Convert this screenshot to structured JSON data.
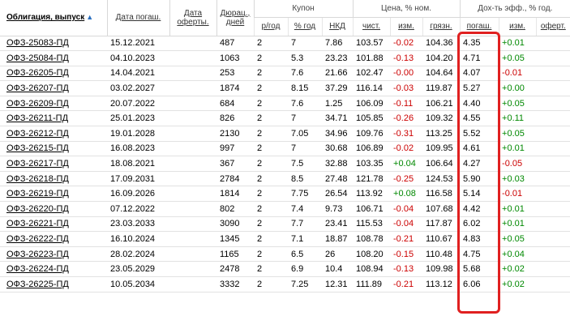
{
  "header": {
    "bond": "Облигация, выпуск",
    "maturity": "Дата погаш.",
    "offer": "Дата оферты.",
    "duration": "Дюрац., дней",
    "coupon": "Купон",
    "price": "Цена, % ном.",
    "yield": "Дох-ть эфф., % год.",
    "sub": {
      "freq": "р/год",
      "rate": "% год",
      "nkd": "НКД",
      "clean": "чист.",
      "chg": "изм.",
      "dirty": "грязн.",
      "ytm": "погаш.",
      "ychg": "изм.",
      "yoffer": "оферт."
    }
  },
  "rows": [
    {
      "name": "ОФЗ-25083-ПД",
      "mat": "15.12.2021",
      "dur": "487",
      "freq": "2",
      "rate": "7",
      "nkd": "7.86",
      "clean": "103.57",
      "chg": "-0.02",
      "dirty": "104.36",
      "ytm": "4.35",
      "ychg": "+0.01"
    },
    {
      "name": "ОФЗ-25084-ПД",
      "mat": "04.10.2023",
      "dur": "1063",
      "freq": "2",
      "rate": "5.3",
      "nkd": "23.23",
      "clean": "101.88",
      "chg": "-0.13",
      "dirty": "104.20",
      "ytm": "4.71",
      "ychg": "+0.05"
    },
    {
      "name": "ОФЗ-26205-ПД",
      "mat": "14.04.2021",
      "dur": "253",
      "freq": "2",
      "rate": "7.6",
      "nkd": "21.66",
      "clean": "102.47",
      "chg": "-0.00",
      "dirty": "104.64",
      "ytm": "4.07",
      "ychg": "-0.01"
    },
    {
      "name": "ОФЗ-26207-ПД",
      "mat": "03.02.2027",
      "dur": "1874",
      "freq": "2",
      "rate": "8.15",
      "nkd": "37.29",
      "clean": "116.14",
      "chg": "-0.03",
      "dirty": "119.87",
      "ytm": "5.27",
      "ychg": "+0.00"
    },
    {
      "name": "ОФЗ-26209-ПД",
      "mat": "20.07.2022",
      "dur": "684",
      "freq": "2",
      "rate": "7.6",
      "nkd": "1.25",
      "clean": "106.09",
      "chg": "-0.11",
      "dirty": "106.21",
      "ytm": "4.40",
      "ychg": "+0.05"
    },
    {
      "name": "ОФЗ-26211-ПД",
      "mat": "25.01.2023",
      "dur": "826",
      "freq": "2",
      "rate": "7",
      "nkd": "34.71",
      "clean": "105.85",
      "chg": "-0.26",
      "dirty": "109.32",
      "ytm": "4.55",
      "ychg": "+0.11"
    },
    {
      "name": "ОФЗ-26212-ПД",
      "mat": "19.01.2028",
      "dur": "2130",
      "freq": "2",
      "rate": "7.05",
      "nkd": "34.96",
      "clean": "109.76",
      "chg": "-0.31",
      "dirty": "113.25",
      "ytm": "5.52",
      "ychg": "+0.05"
    },
    {
      "name": "ОФЗ-26215-ПД",
      "mat": "16.08.2023",
      "dur": "997",
      "freq": "2",
      "rate": "7",
      "nkd": "30.68",
      "clean": "106.89",
      "chg": "-0.02",
      "dirty": "109.95",
      "ytm": "4.61",
      "ychg": "+0.01"
    },
    {
      "name": "ОФЗ-26217-ПД",
      "mat": "18.08.2021",
      "dur": "367",
      "freq": "2",
      "rate": "7.5",
      "nkd": "32.88",
      "clean": "103.35",
      "chg": "+0.04",
      "dirty": "106.64",
      "ytm": "4.27",
      "ychg": "-0.05"
    },
    {
      "name": "ОФЗ-26218-ПД",
      "mat": "17.09.2031",
      "dur": "2784",
      "freq": "2",
      "rate": "8.5",
      "nkd": "27.48",
      "clean": "121.78",
      "chg": "-0.25",
      "dirty": "124.53",
      "ytm": "5.90",
      "ychg": "+0.03"
    },
    {
      "name": "ОФЗ-26219-ПД",
      "mat": "16.09.2026",
      "dur": "1814",
      "freq": "2",
      "rate": "7.75",
      "nkd": "26.54",
      "clean": "113.92",
      "chg": "+0.08",
      "dirty": "116.58",
      "ytm": "5.14",
      "ychg": "-0.01"
    },
    {
      "name": "ОФЗ-26220-ПД",
      "mat": "07.12.2022",
      "dur": "802",
      "freq": "2",
      "rate": "7.4",
      "nkd": "9.73",
      "clean": "106.71",
      "chg": "-0.04",
      "dirty": "107.68",
      "ytm": "4.42",
      "ychg": "+0.01"
    },
    {
      "name": "ОФЗ-26221-ПД",
      "mat": "23.03.2033",
      "dur": "3090",
      "freq": "2",
      "rate": "7.7",
      "nkd": "23.41",
      "clean": "115.53",
      "chg": "-0.04",
      "dirty": "117.87",
      "ytm": "6.02",
      "ychg": "+0.01"
    },
    {
      "name": "ОФЗ-26222-ПД",
      "mat": "16.10.2024",
      "dur": "1345",
      "freq": "2",
      "rate": "7.1",
      "nkd": "18.87",
      "clean": "108.78",
      "chg": "-0.21",
      "dirty": "110.67",
      "ytm": "4.83",
      "ychg": "+0.05"
    },
    {
      "name": "ОФЗ-26223-ПД",
      "mat": "28.02.2024",
      "dur": "1165",
      "freq": "2",
      "rate": "6.5",
      "nkd": "26",
      "clean": "108.20",
      "chg": "-0.15",
      "dirty": "110.48",
      "ytm": "4.75",
      "ychg": "+0.04"
    },
    {
      "name": "ОФЗ-26224-ПД",
      "mat": "23.05.2029",
      "dur": "2478",
      "freq": "2",
      "rate": "6.9",
      "nkd": "10.4",
      "clean": "108.94",
      "chg": "-0.13",
      "dirty": "109.98",
      "ytm": "5.68",
      "ychg": "+0.02"
    },
    {
      "name": "ОФЗ-26225-ПД",
      "mat": "10.05.2034",
      "dur": "3332",
      "freq": "2",
      "rate": "7.25",
      "nkd": "12.31",
      "clean": "111.89",
      "chg": "-0.21",
      "dirty": "113.12",
      "ytm": "6.06",
      "ychg": "+0.02"
    }
  ],
  "colors": {
    "negative": "#cc0000",
    "positive": "#008800",
    "highlight": "#e02020"
  }
}
